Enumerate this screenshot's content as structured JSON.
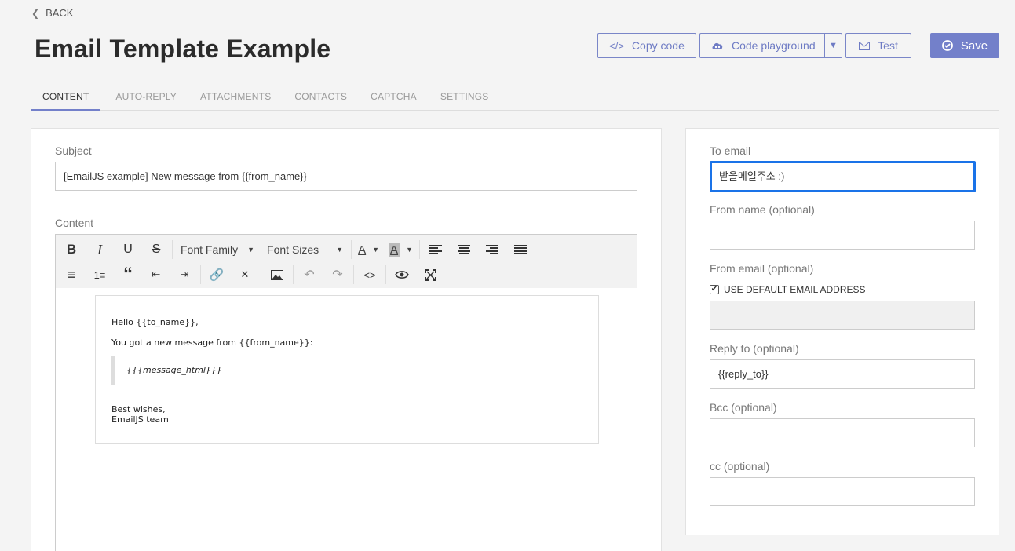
{
  "nav": {
    "back_label": "BACK"
  },
  "header": {
    "title": "Email Template Example"
  },
  "actions": {
    "copy_code": "Copy code",
    "code_playground": "Code playground",
    "test": "Test",
    "save": "Save"
  },
  "tabs": [
    {
      "label": "CONTENT",
      "active": true
    },
    {
      "label": "AUTO-REPLY",
      "active": false
    },
    {
      "label": "ATTACHMENTS",
      "active": false
    },
    {
      "label": "CONTACTS",
      "active": false
    },
    {
      "label": "CAPTCHA",
      "active": false
    },
    {
      "label": "SETTINGS",
      "active": false
    }
  ],
  "subject": {
    "label": "Subject",
    "value": "[EmailJS example] New message from {{from_name}}"
  },
  "content": {
    "label": "Content",
    "toolbar": {
      "font_family": "Font Family",
      "font_sizes": "Font Sizes"
    },
    "body": {
      "line1": "Hello {{to_name}},",
      "line2": "You got a new message from {{from_name}}:",
      "quote": "{{{message_html}}}",
      "line3": "Best wishes,",
      "line4": "EmailJS team"
    }
  },
  "right": {
    "to_email": {
      "label": "To email",
      "value": "받을메일주소 ;)"
    },
    "from_name": {
      "label": "From name (optional)",
      "value": ""
    },
    "from_email": {
      "label": "From email (optional)",
      "checkbox_label": "USE DEFAULT EMAIL ADDRESS",
      "checked": true,
      "value": ""
    },
    "reply_to": {
      "label": "Reply to (optional)",
      "value": "{{reply_to}}"
    },
    "bcc": {
      "label": "Bcc (optional)",
      "value": ""
    },
    "cc": {
      "label": "cc (optional)",
      "value": ""
    }
  },
  "colors": {
    "accent": "#7380ca",
    "focus": "#1a73e8"
  }
}
